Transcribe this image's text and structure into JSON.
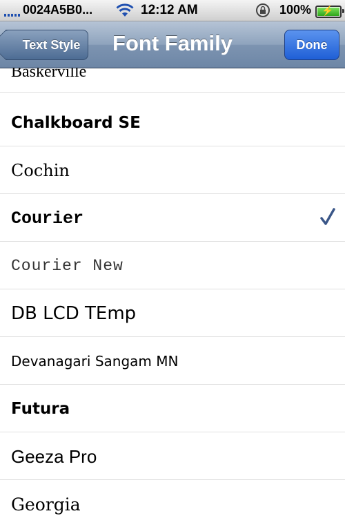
{
  "status_bar": {
    "carrier": "0024A5B0...",
    "time": "12:12 AM",
    "battery_percent": "100%",
    "signal_bars": 4,
    "icons": [
      "signal-icon",
      "wifi-icon",
      "rotation-lock-icon",
      "battery-charging-icon"
    ]
  },
  "nav": {
    "back_label": "Text Style",
    "title": "Font Family",
    "done_label": "Done"
  },
  "colors": {
    "navbar": "#7d94b1",
    "done_button": "#2a6ae0",
    "checkmark": "#3a5688"
  },
  "fonts": {
    "selected": "Courier",
    "items": [
      {
        "label": "Baskerville"
      },
      {
        "label": "Chalkboard SE"
      },
      {
        "label": "Cochin"
      },
      {
        "label": "Courier",
        "selected": true
      },
      {
        "label": "Courier New"
      },
      {
        "label": "DB LCD TEmp"
      },
      {
        "label": "Devanagari Sangam MN"
      },
      {
        "label": "Futura"
      },
      {
        "label": "Geeza Pro"
      },
      {
        "label": "Georgia"
      }
    ]
  }
}
